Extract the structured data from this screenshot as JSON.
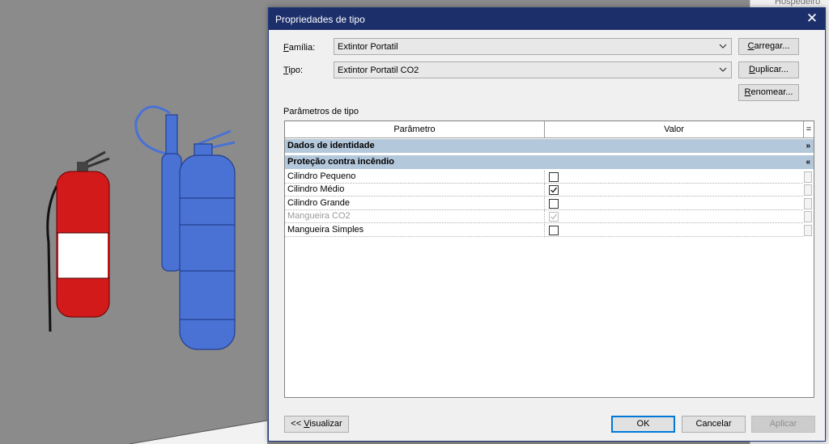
{
  "dialog": {
    "title": "Propriedades de tipo",
    "familia_label_prefix": "F",
    "familia_label_rest": "amília:",
    "familia_value": "Extintor Portatil",
    "tipo_label_prefix": "T",
    "tipo_label_rest": "ipo:",
    "tipo_value": "Extintor Portatil CO2",
    "carregar_prefix": "C",
    "carregar_rest": "arregar...",
    "duplicar_prefix": "D",
    "duplicar_rest": "uplicar...",
    "renomear_prefix": "R",
    "renomear_rest": "enomear...",
    "section_label": "Parâmetros de tipo"
  },
  "grid": {
    "col_parametro": "Parâmetro",
    "col_valor": "Valor",
    "col_menu": "=",
    "groups": [
      {
        "label": "Dados de identidade",
        "chevron": "»",
        "expanded": false
      },
      {
        "label": "Proteção contra incêndio",
        "chevron": "«",
        "expanded": true
      }
    ],
    "rows": [
      {
        "name": "Cilindro Pequeno",
        "checked": false,
        "disabled": false
      },
      {
        "name": "Cilindro Médio",
        "checked": true,
        "disabled": false
      },
      {
        "name": "Cilindro Grande",
        "checked": false,
        "disabled": false
      },
      {
        "name": "Mangueira CO2",
        "checked": true,
        "disabled": true
      },
      {
        "name": "Mangueira Simples",
        "checked": false,
        "disabled": false
      }
    ]
  },
  "footer": {
    "visualizar_prefix": "<< ",
    "visualizar_u": "V",
    "visualizar_rest": "isualizar",
    "ok_label": "OK",
    "cancelar_label": "Cancelar",
    "aplicar_label": "Aplicar"
  },
  "host_panel": {
    "peek_label": "Hospedeiro"
  },
  "colors": {
    "titlebar": "#1c2f6b",
    "group_band": "#b4c8dc",
    "primary_border": "#0078d7",
    "extinguisher_red": "#d31a1a",
    "selection_blue": "#4a72d4"
  }
}
